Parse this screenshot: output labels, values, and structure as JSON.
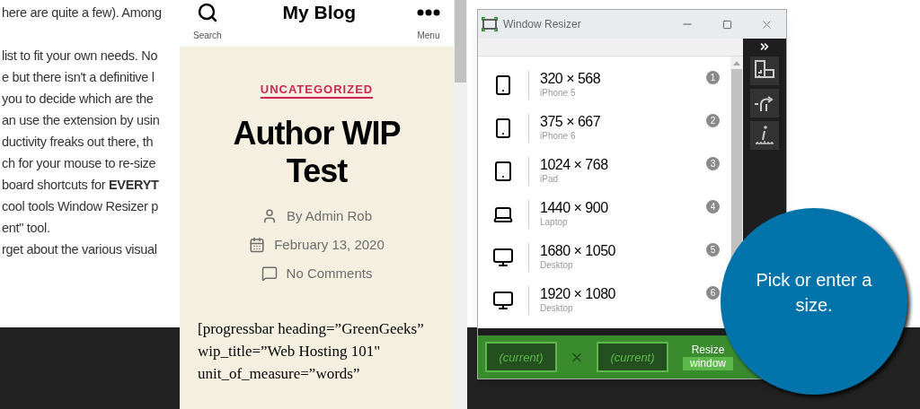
{
  "article": {
    "intro_line": "here are quite a few). Among",
    "lines": [
      "list to fit your own needs. No",
      "e but there isn't a definitive l",
      "you to decide which are the",
      "an use the extension by usin",
      "ductivity freaks out there, th",
      "ch for your mouse to re-size",
      "board shortcuts for **EVERYT**",
      "cool tools Window Resizer p",
      "ent\" tool.",
      "rget about the various visual"
    ]
  },
  "blog": {
    "search_label": "Search",
    "title": "My Blog",
    "menu_label": "Menu",
    "category": "UNCATEGORIZED",
    "post_title": "Author WIP Test",
    "meta": [
      {
        "kind": "author",
        "text": "By Admin Rob"
      },
      {
        "kind": "date",
        "text": "February 13, 2020"
      },
      {
        "kind": "comments",
        "text": "No Comments"
      }
    ],
    "content_lines": [
      "[progressbar heading=”GreenGeeks”",
      "wip_title=”Web Hosting 101\"",
      "unit_of_measure=”words”"
    ]
  },
  "resizer": {
    "title": "Window Resizer",
    "presets": [
      {
        "kind": "phone",
        "size": "320 × 568",
        "device": "iPhone 5",
        "number": "1"
      },
      {
        "kind": "phone",
        "size": "375 × 667",
        "device": "iPhone 6",
        "number": "2"
      },
      {
        "kind": "tablet",
        "size": "1024 × 768",
        "device": "iPad",
        "number": "3"
      },
      {
        "kind": "laptop",
        "size": "1440 × 900",
        "device": "Laptop",
        "number": "4"
      },
      {
        "kind": "desktop",
        "size": "1680 × 1050",
        "device": "Desktop",
        "number": "5"
      },
      {
        "kind": "desktop",
        "size": "1920 × 1080",
        "device": "Desktop",
        "number": "6"
      }
    ],
    "width_placeholder": "(current)",
    "times": "×",
    "height_placeholder": "(current)",
    "resize_label": "Resize",
    "resize_sublabel": "window"
  },
  "callout": {
    "text": "Pick or enter a size."
  }
}
